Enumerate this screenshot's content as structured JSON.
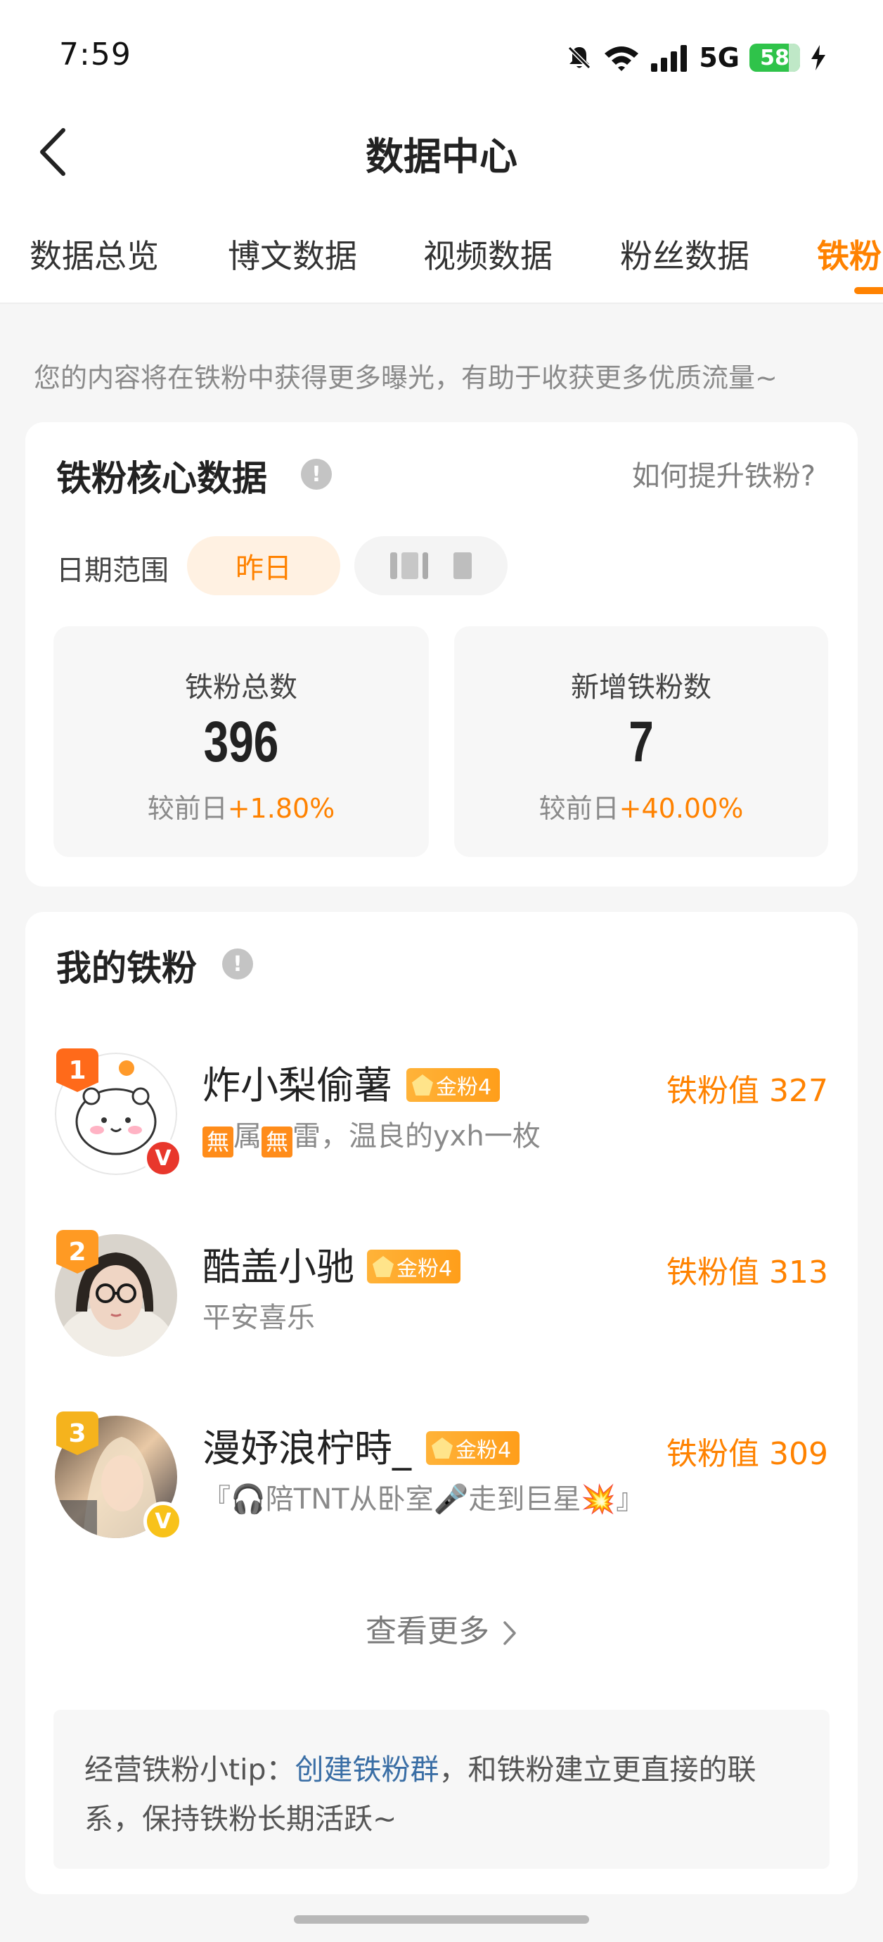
{
  "status_bar": {
    "time": "7:59",
    "network": "5G",
    "battery": "58",
    "icons": [
      "mute-bell-icon",
      "wifi-icon",
      "signal-icon",
      "charging-bolt-icon"
    ]
  },
  "nav": {
    "title": "数据中心",
    "back_icon": "chevron-left-icon"
  },
  "tabs": [
    {
      "label": "数据总览",
      "active": false
    },
    {
      "label": "博文数据",
      "active": false
    },
    {
      "label": "视频数据",
      "active": false
    },
    {
      "label": "粉丝数据",
      "active": false
    },
    {
      "label": "铁粉",
      "active": true
    }
  ],
  "notice": "您的内容将在铁粉中获得更多曝光，有助于收获更多优质流量~",
  "core": {
    "title": "铁粉核心数据",
    "help_link": "如何提升铁粉?",
    "range_label": "日期范围",
    "range_options": [
      "昨日"
    ],
    "stats": [
      {
        "label": "铁粉总数",
        "value": "396",
        "compare_label": "较前日",
        "compare_value": "+1.80%"
      },
      {
        "label": "新增铁粉数",
        "value": "7",
        "compare_label": "较前日",
        "compare_value": "+40.00%"
      }
    ]
  },
  "fans": {
    "title": "我的铁粉",
    "list": [
      {
        "rank": "1",
        "name": "炸小梨偷薯",
        "badge": "金粉4",
        "value": "铁粉值 327",
        "sign_parts": [
          "無",
          "属",
          "無",
          "雷，温良的yxh一枚"
        ]
      },
      {
        "rank": "2",
        "name": "酷盖小驰",
        "badge": "金粉4",
        "value": "铁粉值 313",
        "sign": "平安喜乐"
      },
      {
        "rank": "3",
        "name": "漫妤浪柠時_",
        "badge": "金粉4",
        "value": "铁粉值 309",
        "sign": "『🎧陪TNT从卧室🎤走到巨星💥』"
      }
    ],
    "see_more": "查看更多",
    "tip_prefix": "经营铁粉小tip：",
    "tip_link": "创建铁粉群",
    "tip_suffix": "，和铁粉建立更直接的联系，保持铁粉长期活跃~"
  },
  "colors": {
    "accent": "#ff8200",
    "link": "#3a6ea5",
    "background": "#f6f6f6"
  }
}
